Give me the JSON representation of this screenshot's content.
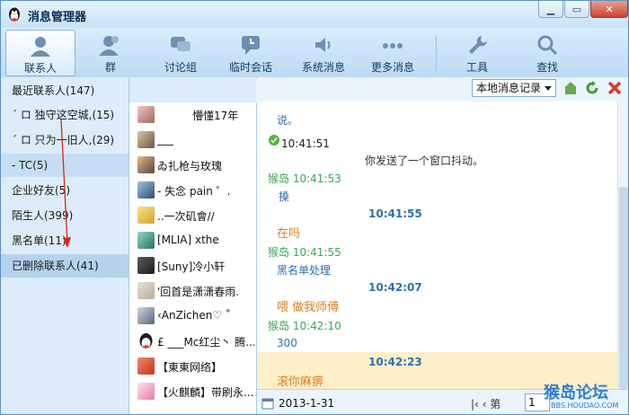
{
  "window": {
    "title": "消息管理器"
  },
  "toolbar": {
    "items": [
      {
        "label": "联系人",
        "icon": "person-icon"
      },
      {
        "label": "群",
        "icon": "group-icon"
      },
      {
        "label": "讨论组",
        "icon": "discussion-icon"
      },
      {
        "label": "临时会话",
        "icon": "temp-chat-icon"
      },
      {
        "label": "系统消息",
        "icon": "speaker-icon"
      },
      {
        "label": "更多消息",
        "icon": "more-icon"
      },
      {
        "label": "工具",
        "icon": "wrench-icon"
      },
      {
        "label": "查找",
        "icon": "search-icon"
      }
    ]
  },
  "leftnav": {
    "items": [
      {
        "label": "最近联系人(147)"
      },
      {
        "label": "ˊ ロ 独守这空城,(15)"
      },
      {
        "label": "ˊ ロ 只为一旧人,(29)"
      },
      {
        "label": "- TC(5)"
      },
      {
        "label": "企业好友(5)"
      },
      {
        "label": "陌生人(399)"
      },
      {
        "label": "黑名单(11)"
      },
      {
        "label": "已删除联系人(41)"
      }
    ]
  },
  "contacts": [
    {
      "name": "懵懂17年"
    },
    {
      "name": "___"
    },
    {
      "name": "ゐ扎枪与玫瑰"
    },
    {
      "name": "- 失念   pain ゜."
    },
    {
      "name": "..一次矶會//"
    },
    {
      "name": "[MLIA]  xthe"
    },
    {
      "name": "[Suny]冷小轩"
    },
    {
      "name": "'回首是潇潇春雨."
    },
    {
      "name": "‹AnZichen♡ ˚"
    },
    {
      "name": "£ ___Mc红尘丶 腾..."
    },
    {
      "name": "【東東网络】"
    },
    {
      "name": "【火麒麟】带刷永..."
    }
  ],
  "messages": {
    "history_select": "本地消息记录",
    "lines": [
      {
        "text": "说。",
        "kind": "blue"
      },
      {
        "text": "10:41:51",
        "kind": "time"
      },
      {
        "text": "你发送了一个窗口抖动。",
        "kind": "sys"
      },
      {
        "text": "猴岛 10:41:53",
        "kind": "peer"
      },
      {
        "text": "搡",
        "kind": "blue"
      },
      {
        "text": "10:41:55",
        "kind": "mine"
      },
      {
        "text": "在吗",
        "kind": "orange"
      },
      {
        "text": "猴岛 10:41:55",
        "kind": "peer"
      },
      {
        "text": "黑名单处理",
        "kind": "blue"
      },
      {
        "text": "10:42:07",
        "kind": "mine"
      },
      {
        "text": "喂 做我师傅",
        "kind": "orange"
      },
      {
        "text": "猴岛 10:42:10",
        "kind": "peer"
      },
      {
        "text": "300",
        "kind": "blue"
      },
      {
        "text": "10:42:23",
        "kind": "mine"
      },
      {
        "text": "滚你麻痹",
        "kind": "orange"
      }
    ]
  },
  "footer": {
    "date": "2013-1-31",
    "pager": "|‹  ‹  第",
    "page": "1"
  },
  "watermark": {
    "main": "猴岛论坛",
    "sub": "BBS.HOUDAO.COM"
  },
  "colors": {
    "accent": "#2f6fb4",
    "peer": "#3aa657",
    "orange": "#e07c22",
    "highlight": "#fdf0c8"
  }
}
